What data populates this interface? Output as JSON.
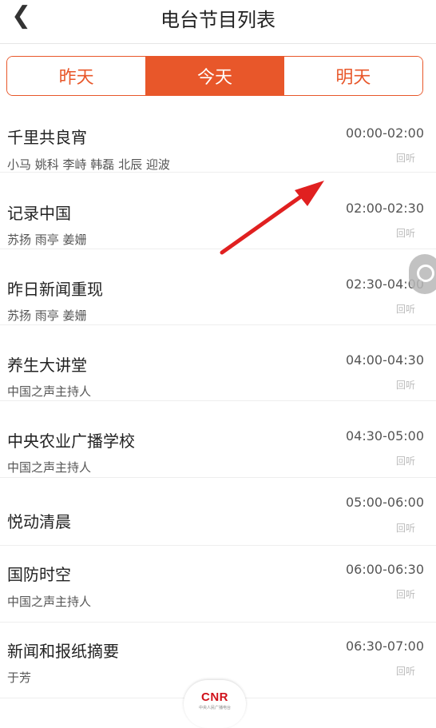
{
  "header": {
    "back_icon": "chevron-left-icon",
    "title": "电台节目列表"
  },
  "tabs": [
    {
      "label": "昨天",
      "active": false
    },
    {
      "label": "今天",
      "active": true
    },
    {
      "label": "明天",
      "active": false
    }
  ],
  "colors": {
    "accent": "#e8572a",
    "annotation_arrow": "#e02020"
  },
  "programs": [
    {
      "title": "千里共良宵",
      "hosts": "小马 姚科 李峙 韩磊 北辰 迎波",
      "time": "00:00-02:00",
      "replay": "回听"
    },
    {
      "title": "记录中国",
      "hosts": "苏扬 雨亭 姜姗",
      "time": "02:00-02:30",
      "replay": "回听"
    },
    {
      "title": "昨日新闻重现",
      "hosts": "苏扬 雨亭 姜姗",
      "time": "02:30-04:00",
      "replay": "回听"
    },
    {
      "title": "养生大讲堂",
      "hosts": "中国之声主持人",
      "time": "04:00-04:30",
      "replay": "回听"
    },
    {
      "title": "中央农业广播学校",
      "hosts": "中国之声主持人",
      "time": "04:30-05:00",
      "replay": "回听"
    },
    {
      "title": "悦动清晨",
      "hosts": "",
      "time": "05:00-06:00",
      "replay": "回听"
    },
    {
      "title": "国防时空",
      "hosts": "中国之声主持人",
      "time": "06:00-06:30",
      "replay": "回听"
    },
    {
      "title": "新闻和报纸摘要",
      "hosts": "于芳",
      "time": "06:30-07:00",
      "replay": "回听"
    }
  ],
  "floating_button": {
    "icon": "shutter-icon"
  },
  "player_logo": {
    "text": "CNR",
    "subtext": "中央人民广播电台"
  }
}
